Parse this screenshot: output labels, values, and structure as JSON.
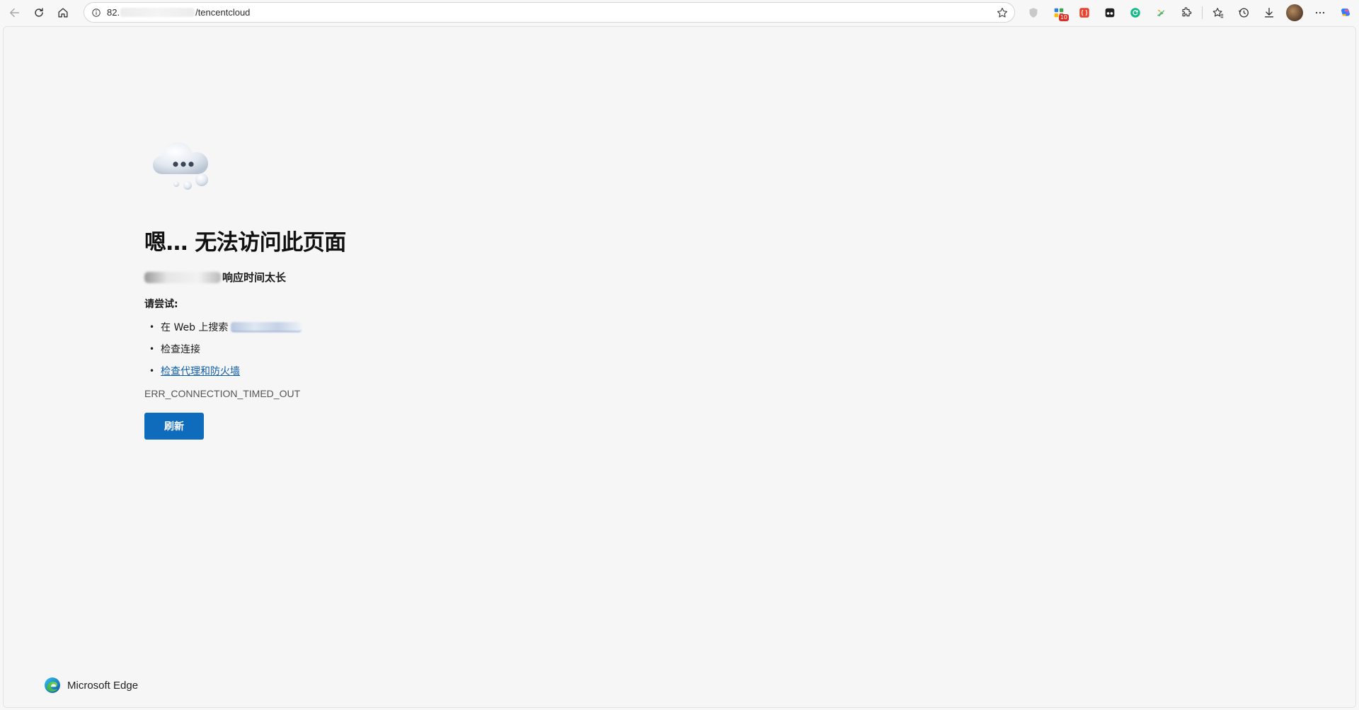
{
  "browser": {
    "url": {
      "host_prefix": "82.",
      "path": "/tencentcloud"
    },
    "extension_badge": "10",
    "icons": {
      "back": "back-arrow-icon",
      "refresh": "refresh-icon",
      "home": "home-icon",
      "site_info": "info-icon",
      "favorite": "star-icon",
      "collections": "collections-icon",
      "favorites": "favorites-icon",
      "history": "history-icon",
      "downloads": "download-icon",
      "extensions": "puzzle-icon",
      "more": "more-icon",
      "copilot": "copilot-icon"
    }
  },
  "error_page": {
    "title": "嗯… 无法访问此页面",
    "subtitle_suffix": "响应时间太长",
    "try_label": "请尝试:",
    "suggestions": [
      {
        "text": "在 Web 上搜索"
      },
      {
        "text": "检查连接"
      },
      {
        "text": "检查代理和防火墙"
      }
    ],
    "error_code": "ERR_CONNECTION_TIMED_OUT",
    "refresh_button": "刷新"
  },
  "footer": {
    "brand": "Microsoft Edge"
  },
  "colors": {
    "accent": "#0f6cbd",
    "link": "#0f5ea8",
    "page_bg": "#f6f6f6"
  }
}
